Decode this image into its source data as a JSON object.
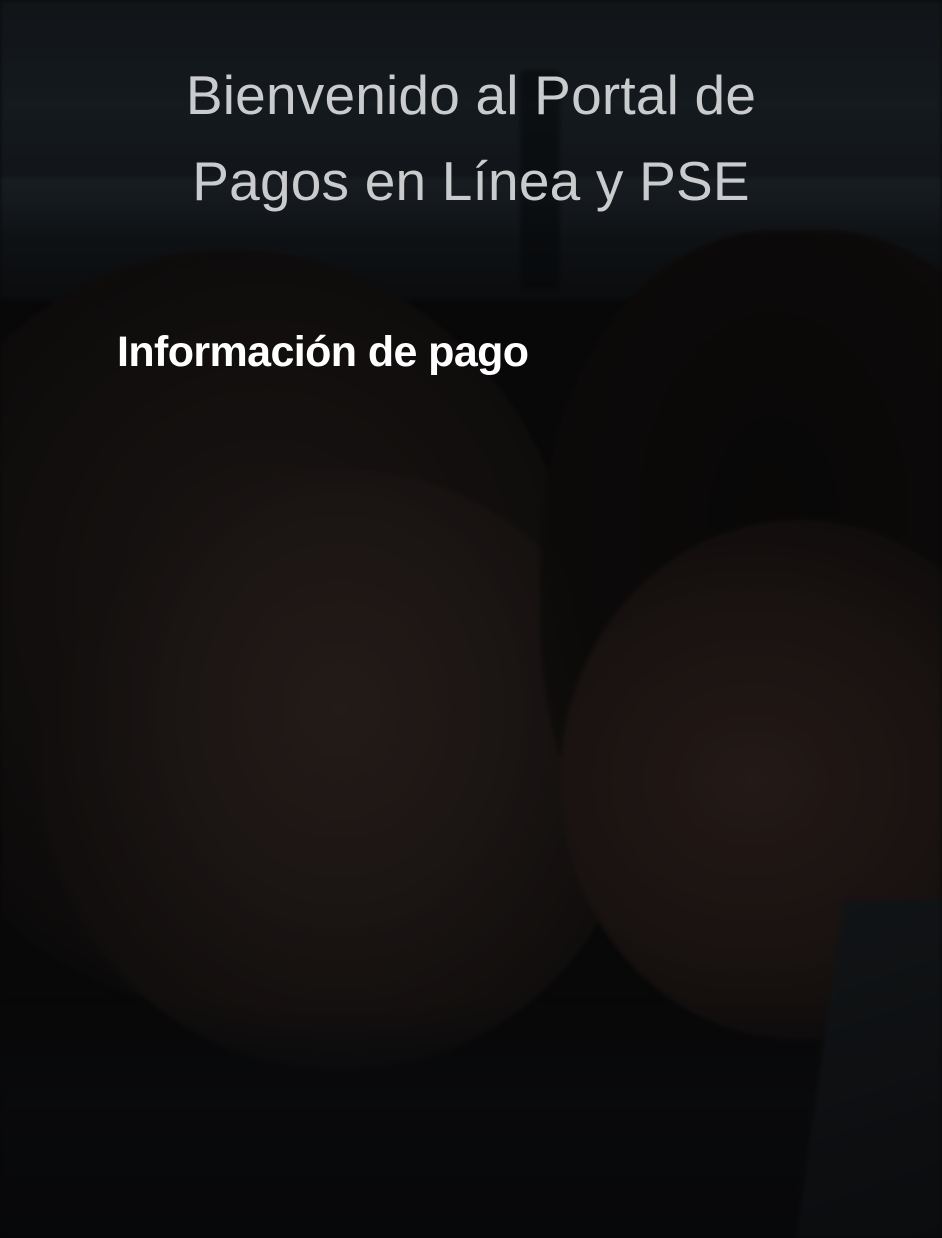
{
  "header": {
    "title_line1": "Bienvenido al Portal de",
    "title_line2": "Pagos en Línea y PSE"
  },
  "section": {
    "title": "Información de pago"
  },
  "colors": {
    "header_text": "#c9cbcd",
    "section_text": "#ffffff",
    "background": "#0d0d0e"
  }
}
